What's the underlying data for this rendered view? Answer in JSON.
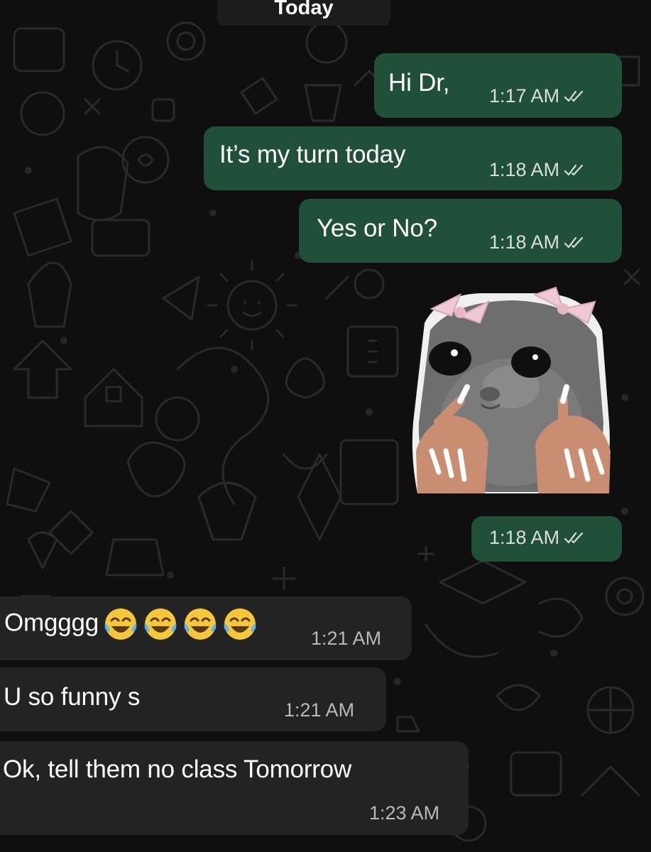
{
  "chat": {
    "date_separator": "Today",
    "messages": [
      {
        "id": "m1",
        "direction": "outgoing",
        "text": "Hi Dr,",
        "time": "1:17 AM",
        "status": "read"
      },
      {
        "id": "m2",
        "direction": "outgoing",
        "text": "It’s my turn today",
        "time": "1:18 AM",
        "status": "read"
      },
      {
        "id": "m3",
        "direction": "outgoing",
        "text": "Yes or No?",
        "time": "1:18 AM",
        "status": "read"
      },
      {
        "id": "m4",
        "direction": "outgoing",
        "type": "sticker",
        "sticker": "sad-hamster-with-bows-and-nails",
        "time": "1:18 AM",
        "status": "read"
      },
      {
        "id": "m5",
        "direction": "incoming",
        "text": "Omgggg",
        "emoji": [
          "face-with-tears-of-joy",
          "face-with-tears-of-joy",
          "face-with-tears-of-joy",
          "face-with-tears-of-joy"
        ],
        "time": "1:21 AM"
      },
      {
        "id": "m6",
        "direction": "incoming",
        "text": "U so funny s",
        "redacted": true,
        "time": "1:21 AM"
      },
      {
        "id": "m7",
        "direction": "incoming",
        "text": "Ok, tell them no class Tomorrow",
        "time": "1:23 AM"
      }
    ]
  },
  "colors": {
    "background": "#0f0f0f",
    "outgoing_bubble": "#21503a",
    "incoming_bubble": "#232323",
    "read_ticks": "#d6dfd9"
  }
}
